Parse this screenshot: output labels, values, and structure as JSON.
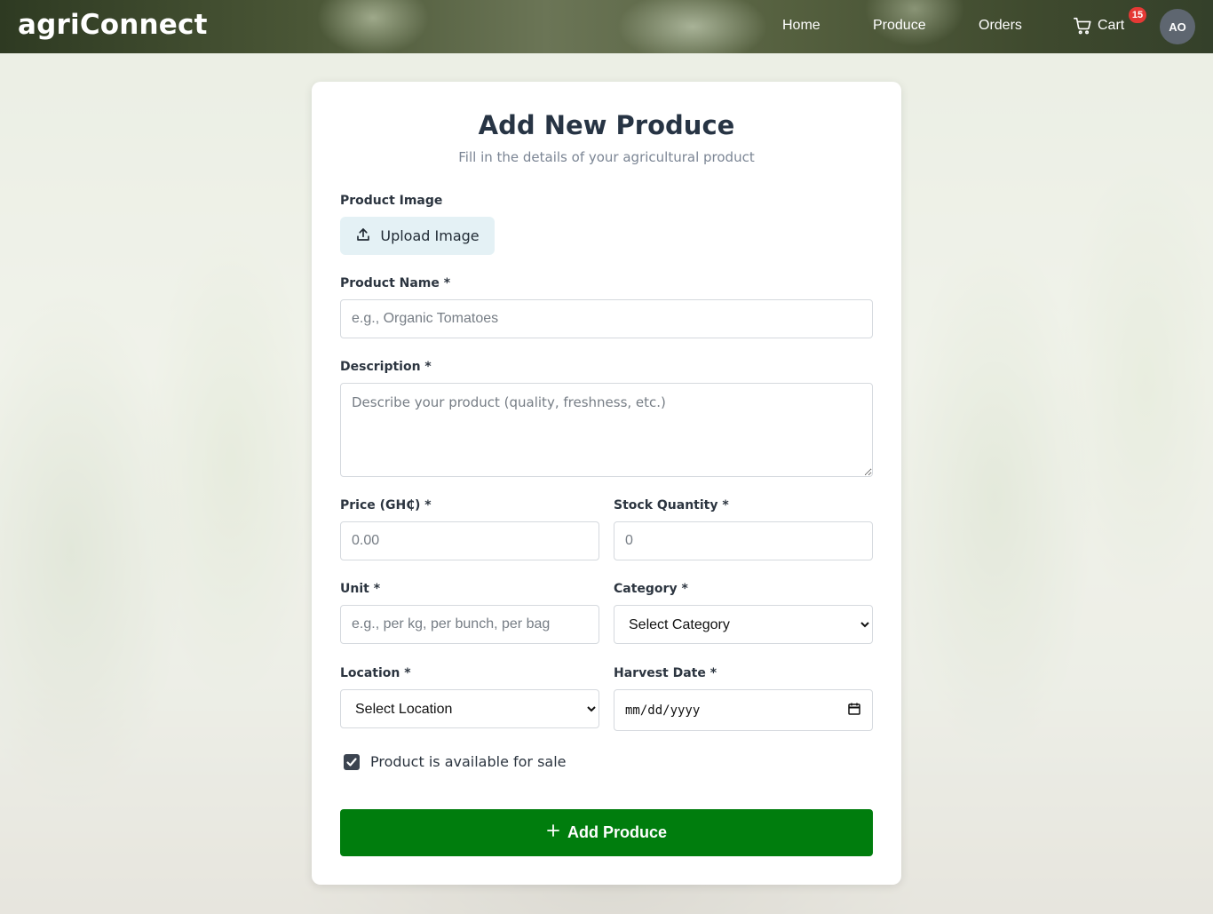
{
  "header": {
    "brand": "agriConnect",
    "nav": {
      "home": "Home",
      "produce": "Produce",
      "orders": "Orders",
      "cart": "Cart"
    },
    "cart_count": "15",
    "avatar_initials": "AO"
  },
  "form": {
    "title": "Add New Produce",
    "subtitle": "Fill in the details of your agricultural product",
    "image_label": "Product Image",
    "upload_label": "Upload Image",
    "name_label": "Product Name *",
    "name_placeholder": "e.g., Organic Tomatoes",
    "description_label": "Description *",
    "description_placeholder": "Describe your product (quality, freshness, etc.)",
    "price_label": "Price (GH₵) *",
    "price_placeholder": "0.00",
    "stock_label": "Stock Quantity *",
    "stock_placeholder": "0",
    "unit_label": "Unit *",
    "unit_placeholder": "e.g., per kg, per bunch, per bag",
    "category_label": "Category *",
    "category_selected": "Select Category",
    "location_label": "Location *",
    "location_selected": "Select Location",
    "harvest_label": "Harvest Date *",
    "harvest_placeholder": "mm/dd/yyyy",
    "available_label": "Product is available for sale",
    "available_checked": true,
    "submit_label": "Add Produce"
  },
  "icons": {
    "upload": "upload-icon",
    "cart": "cart-icon",
    "plus": "plus-icon",
    "calendar": "calendar-icon",
    "check": "check-icon"
  },
  "colors": {
    "primary": "#007d0d",
    "badge": "#e53935",
    "upload_bg": "#e4f1f5",
    "avatar_bg": "#5e6670"
  }
}
